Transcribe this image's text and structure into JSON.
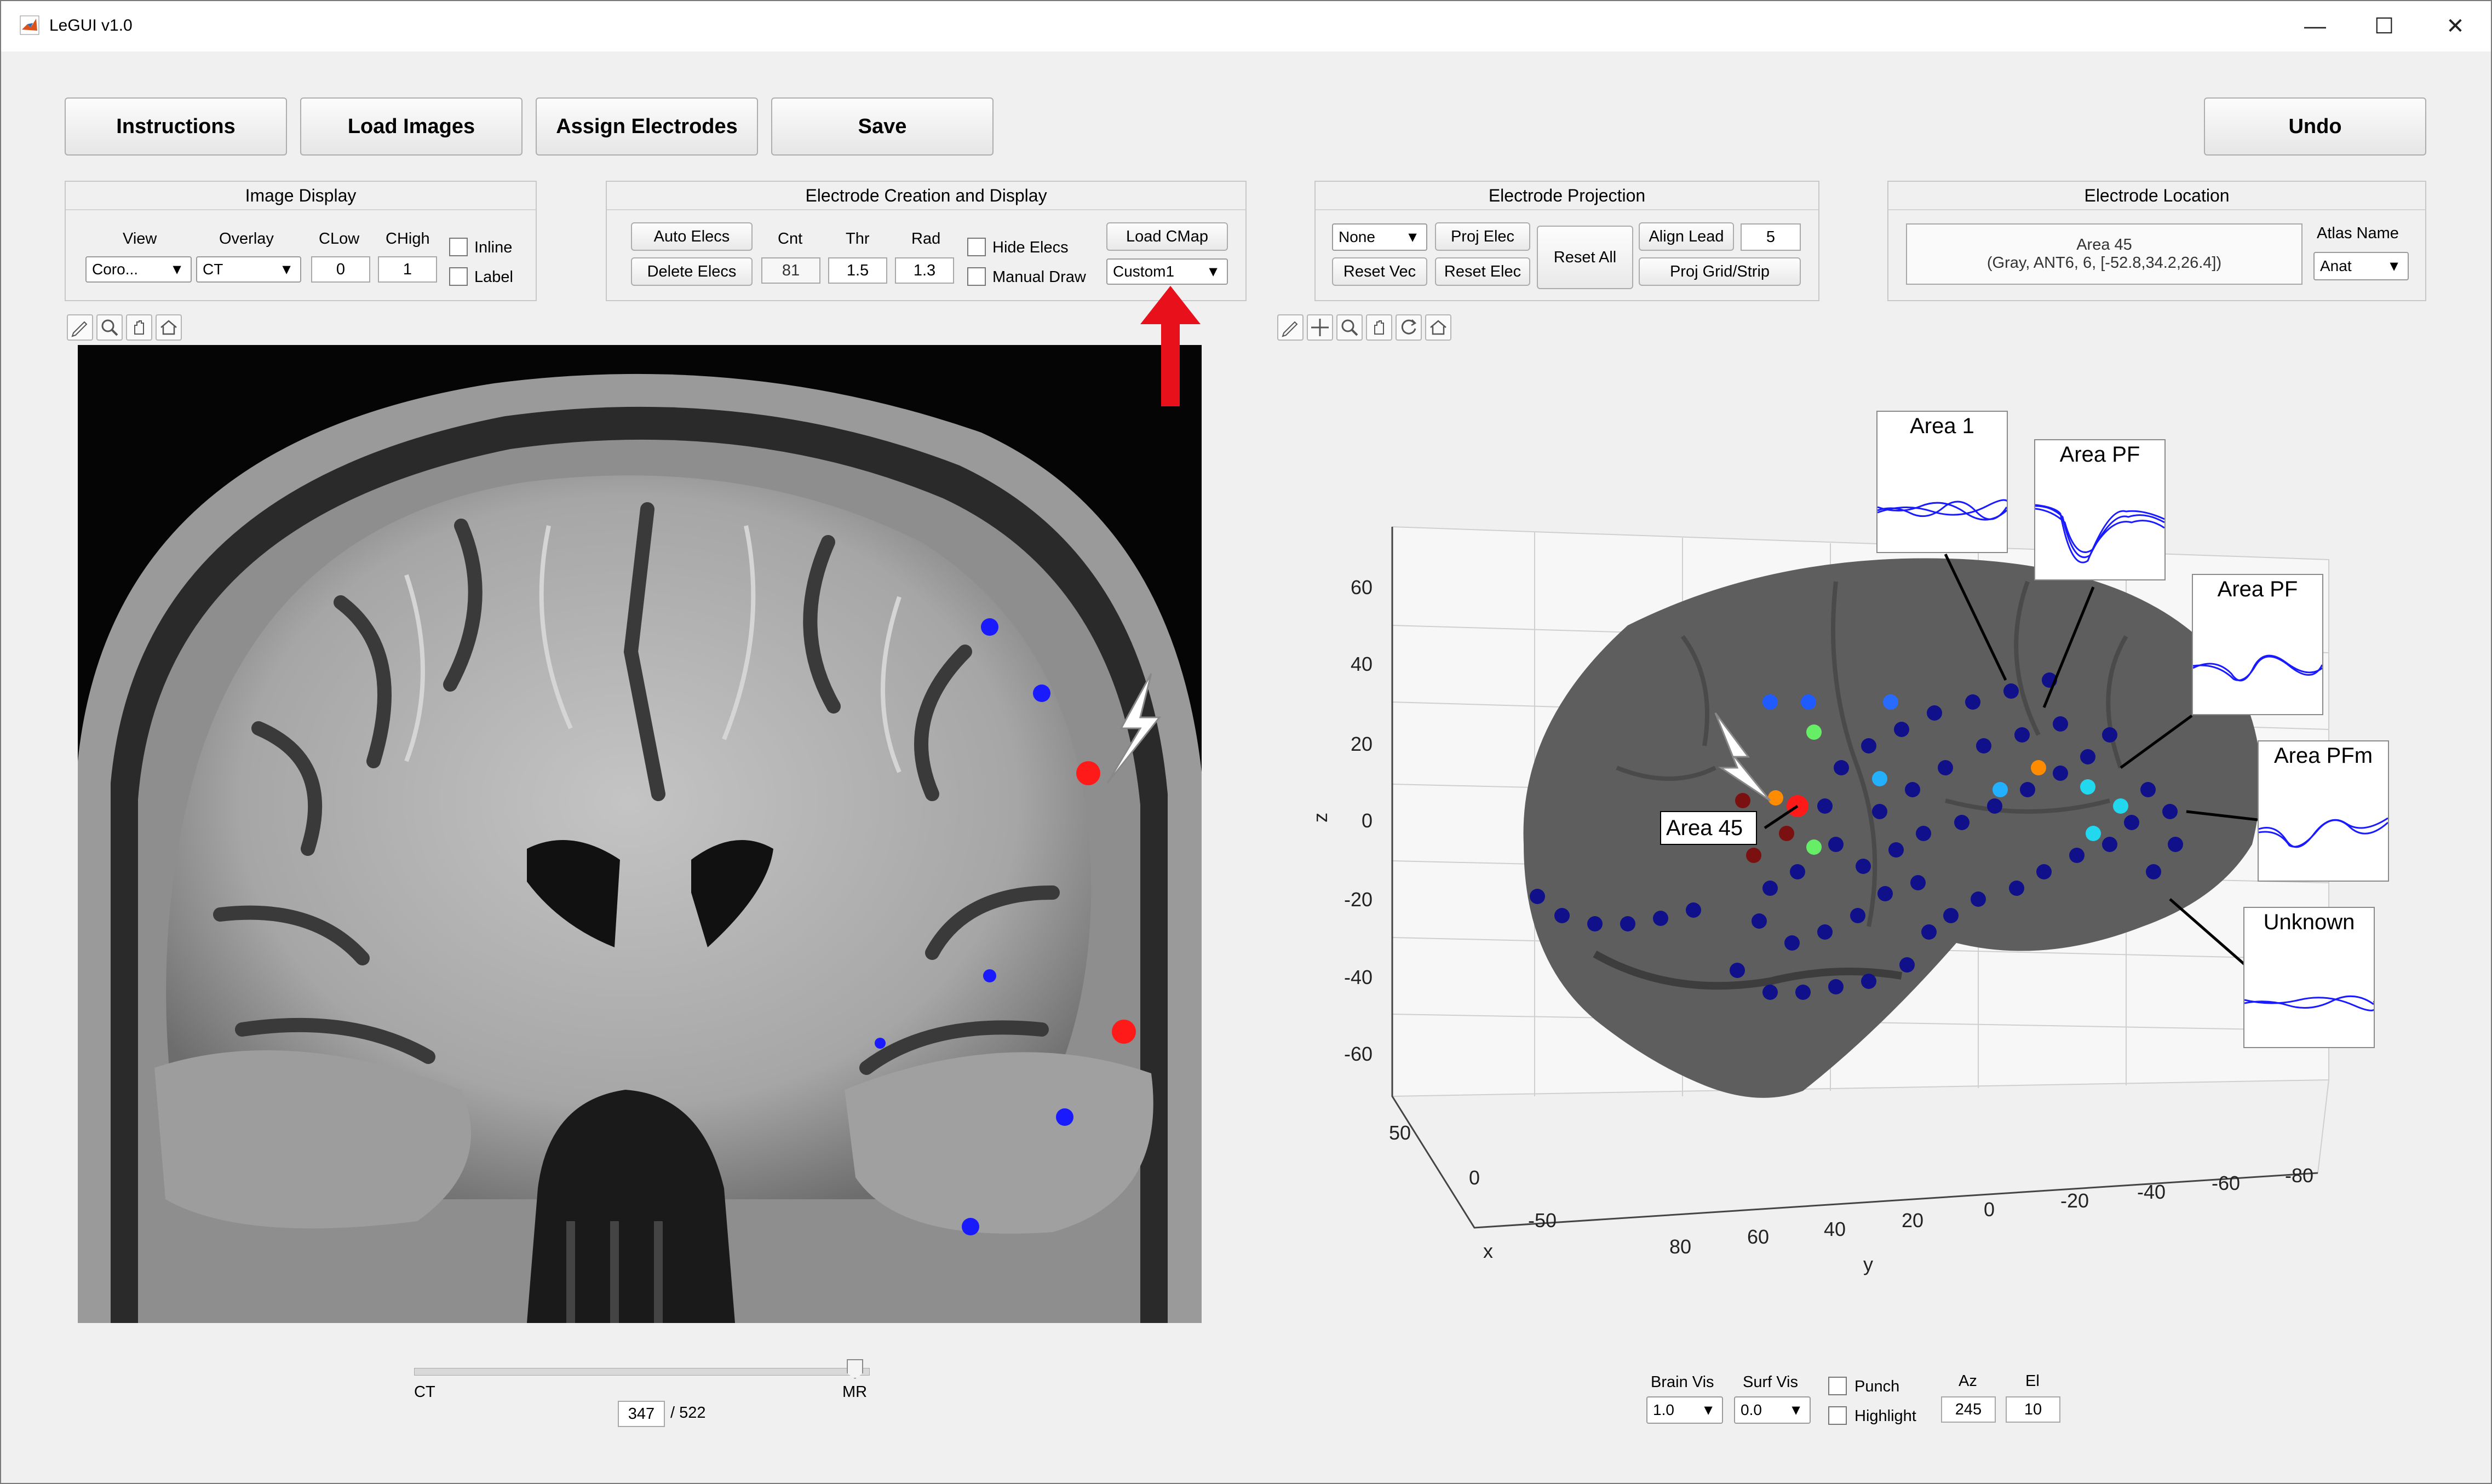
{
  "window": {
    "title": "LeGUI v1.0",
    "controls": [
      "—",
      "☐",
      "✕"
    ]
  },
  "toolbar": {
    "instructions": "Instructions",
    "load_images": "Load Images",
    "assign_electrodes": "Assign Electrodes",
    "save": "Save",
    "undo": "Undo"
  },
  "image_display": {
    "title": "Image Display",
    "view_label": "View",
    "view_value": "Coro...",
    "overlay_label": "Overlay",
    "overlay_value": "CT",
    "clow_label": "CLow",
    "clow_value": "0",
    "chigh_label": "CHigh",
    "chigh_value": "1",
    "inline_label": "Inline",
    "label_label": "Label"
  },
  "electrode_creation": {
    "title": "Electrode Creation and Display",
    "auto_elecs": "Auto Elecs",
    "delete_elecs": "Delete Elecs",
    "cnt_label": "Cnt",
    "cnt_value": "81",
    "thr_label": "Thr",
    "thr_value": "1.5",
    "rad_label": "Rad",
    "rad_value": "1.3",
    "hide_elecs": "Hide Elecs",
    "manual_draw": "Manual Draw",
    "load_cmap": "Load CMap",
    "cmap_value": "Custom1"
  },
  "electrode_projection": {
    "title": "Electrode Projection",
    "vec_value": "None",
    "proj_elec": "Proj Elec",
    "reset_all": "Reset All",
    "align_lead": "Align Lead",
    "align_value": "5",
    "reset_vec": "Reset Vec",
    "reset_elec": "Reset Elec",
    "proj_grid": "Proj Grid/Strip"
  },
  "electrode_location": {
    "title": "Electrode Location",
    "area_name": "Area 45",
    "area_detail": "(Gray, ANT6, 6, [-52.8,34.2,26.4])",
    "atlas_label": "Atlas Name",
    "atlas_value": "Anat"
  },
  "slice_slider": {
    "left_label": "CT",
    "right_label": "MR",
    "value": 347,
    "max_text": "/ 522",
    "position": 0.97
  },
  "brain_plot": {
    "axis_z_label": "z",
    "axis_x_label": "x",
    "axis_y_label": "y",
    "z_ticks": [
      "60",
      "40",
      "20",
      "0",
      "-20",
      "-40",
      "-60"
    ],
    "x_ticks": [
      "50",
      "0",
      "-50"
    ],
    "y_ticks": [
      "80",
      "60",
      "40",
      "20",
      "0",
      "-20",
      "-40",
      "-60",
      "-80"
    ],
    "selected_label": "Area 45",
    "insets": [
      "Area 1",
      "Area PF",
      "Area PF",
      "Area PFm",
      "Unknown"
    ]
  },
  "bottom_controls": {
    "brain_vis_label": "Brain Vis",
    "brain_vis_value": "1.0",
    "surf_vis_label": "Surf Vis",
    "surf_vis_value": "0.0",
    "punch_label": "Punch",
    "highlight_label": "Highlight",
    "az_label": "Az",
    "az_value": "245",
    "el_label": "El",
    "el_value": "10"
  },
  "colors": {
    "electrode_blue": "#1010c8",
    "electrode_selected": "#ff1a1a",
    "arrow_red": "#e8101a",
    "brain_gray": "#5e5e5e",
    "trace_blue": "#1a1aff"
  }
}
